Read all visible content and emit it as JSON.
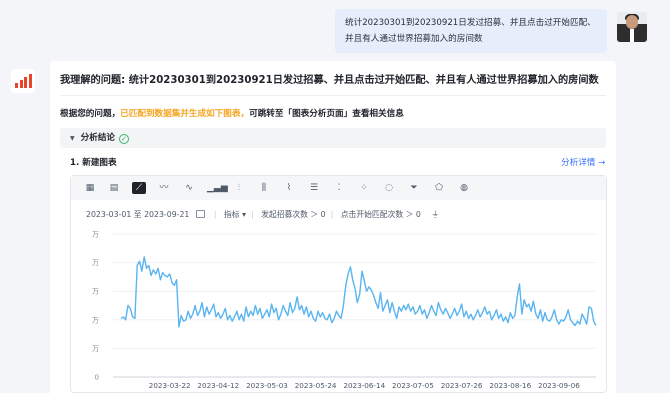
{
  "user_message": {
    "line1": "统计20230301到20230921日发过招募、并且点击过开始匹配、",
    "line2": "并且有人通过世界招募加入的房间数"
  },
  "answer": {
    "title": "我理解的问题: 统计20230301到20230921日发过招募、并且点击过开始匹配、并且有人通过世界招募加入的房间数",
    "hint_prefix": "根据您的问题，",
    "hint_highlight": "已匹配到数据集并生成如下图表，",
    "hint_suffix": "可跳转至「图表分析页面」查看相关信息",
    "hint_highlight_color": "#f5a623"
  },
  "panel": {
    "title": "分析结论",
    "status_icon": "check-circle-icon"
  },
  "section": {
    "title": "1. 新建图表",
    "detail_link": "分析详情 →"
  },
  "filters": {
    "date_start": "2023-03-01",
    "date_to": "至",
    "date_end": "2023-09-21",
    "metric_label": "指标",
    "metric_caret": "▾",
    "condition1": "发起招募次数 ＞ 0",
    "condition2": "点击开始匹配次数 ＞ 0"
  },
  "toolbar_icons": [
    "table-icon",
    "pivot-icon",
    "line-chart-icon",
    "area-chart-icon",
    "stacked-area-icon",
    "bar-chart-icon",
    "stacked-bar-icon",
    "grouped-bar-icon",
    "combo-chart-icon",
    "horizontal-bar-icon",
    "scatter-icon",
    "bubble-icon",
    "donut-icon",
    "funnel-icon",
    "radar-icon",
    "map-icon"
  ],
  "chart_data": {
    "type": "line",
    "x_start": "2023-03-01",
    "x_end": "2023-09-21",
    "xtick_labels": [
      "2023-03-22",
      "2023-04-12",
      "2023-05-03",
      "2023-05-24",
      "2023-06-14",
      "2023-07-05",
      "2023-07-26",
      "2023-08-16",
      "2023-09-06"
    ],
    "ytick_labels": [
      "万",
      "万",
      "万",
      "万",
      "万",
      "0"
    ],
    "ylim": [
      0,
      5
    ],
    "grid": true,
    "color": "#5ab4f0",
    "values": [
      2.05,
      2.1,
      2.0,
      2.5,
      2.4,
      2.1,
      2.05,
      3.9,
      4.05,
      3.7,
      4.2,
      3.8,
      3.9,
      3.55,
      3.75,
      3.6,
      3.8,
      3.4,
      3.65,
      3.55,
      3.5,
      3.6,
      3.3,
      3.2,
      3.4,
      1.75,
      2.15,
      1.95,
      2.0,
      2.3,
      2.05,
      2.2,
      2.5,
      2.15,
      2.3,
      2.6,
      2.1,
      2.45,
      2.2,
      2.35,
      2.55,
      2.1,
      2.25,
      2.05,
      2.2,
      2.4,
      2.0,
      2.15,
      1.95,
      2.1,
      2.3,
      2.0,
      2.2,
      1.95,
      2.45,
      2.1,
      2.3,
      2.15,
      2.5,
      2.2,
      2.4,
      2.05,
      2.2,
      2.35,
      2.1,
      2.55,
      2.25,
      2.4,
      2.0,
      2.2,
      2.5,
      2.3,
      2.15,
      2.6,
      2.25,
      2.4,
      2.8,
      2.35,
      2.5,
      2.2,
      2.45,
      2.1,
      2.3,
      2.05,
      1.95,
      2.3,
      2.1,
      2.25,
      2.05,
      2.0,
      2.2,
      1.9,
      2.05,
      2.3,
      2.15,
      2.05,
      2.5,
      3.2,
      3.6,
      3.85,
      3.4,
      3.1,
      2.6,
      2.9,
      3.7,
      3.35,
      3.0,
      3.15,
      3.05,
      2.85,
      2.6,
      2.4,
      2.95,
      2.3,
      2.5,
      2.7,
      2.25,
      2.6,
      2.3,
      2.05,
      2.45,
      2.3,
      2.5,
      2.35,
      2.55,
      2.3,
      2.45,
      2.2,
      2.3,
      2.5,
      2.2,
      2.35,
      2.05,
      2.25,
      2.5,
      2.3,
      2.15,
      2.6,
      2.35,
      2.2,
      2.4,
      2.25,
      2.05,
      2.2,
      2.4,
      2.15,
      2.3,
      2.55,
      2.1,
      2.3,
      2.05,
      2.2,
      2.0,
      2.15,
      2.35,
      2.1,
      2.25,
      2.45,
      2.2,
      2.3,
      2.0,
      2.15,
      2.35,
      2.05,
      2.2,
      1.95,
      2.1,
      1.9,
      2.25,
      2.05,
      2.15,
      2.8,
      3.25,
      2.2,
      2.7,
      2.45,
      2.55,
      2.3,
      2.65,
      2.2,
      2.05,
      2.35,
      1.95,
      2.25,
      2.0,
      1.95,
      2.1,
      2.35,
      2.0,
      1.85,
      2.0,
      1.95,
      2.1,
      2.35,
      2.0,
      1.9,
      1.8,
      1.95,
      1.85,
      2.2,
      2.05,
      1.85,
      2.45,
      2.4,
      1.95,
      1.8
    ]
  }
}
